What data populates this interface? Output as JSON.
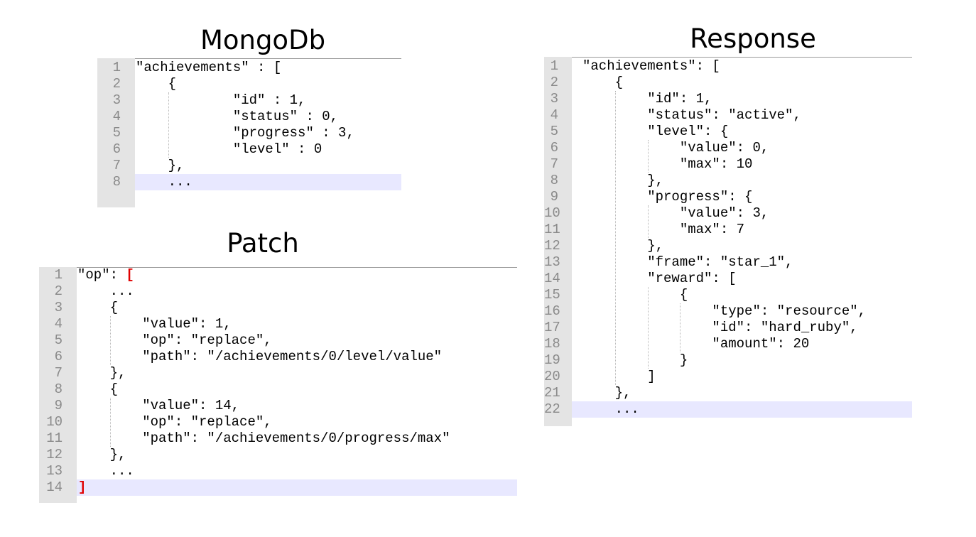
{
  "mongodb": {
    "title": "MongoDb",
    "lines": [
      "\"achievements\" : [",
      "    {",
      "            \"id\" : 1,",
      "            \"status\" : 0,",
      "            \"progress\" : 3,",
      "            \"level\" : 0",
      "    },",
      "    ..."
    ],
    "highlight_line": 8
  },
  "patch": {
    "title": "Patch",
    "lines": [
      "\"op\": [",
      "    ...",
      "    {",
      "        \"value\": 1,",
      "        \"op\": \"replace\",",
      "        \"path\": \"/achievements/0/level/value\"",
      "    },",
      "    {",
      "        \"value\": 14,",
      "        \"op\": \"replace\",",
      "        \"path\": \"/achievements/0/progress/max\"",
      "    },",
      "    ...",
      "]"
    ],
    "highlight_line": 14,
    "accent_color": "#e00000"
  },
  "response": {
    "title": "Response",
    "lines": [
      "\"achievements\": [",
      "    {",
      "        \"id\": 1,",
      "        \"status\": \"active\",",
      "        \"level\": {",
      "            \"value\": 0,",
      "            \"max\": 10",
      "        },",
      "        \"progress\": {",
      "            \"value\": 3,",
      "            \"max\": 7",
      "        },",
      "        \"frame\": \"star_1\",",
      "        \"reward\": [",
      "            {",
      "                \"type\": \"resource\",",
      "                \"id\": \"hard_ruby\",",
      "                \"amount\": 20",
      "            }",
      "        ]",
      "    },",
      "    ..."
    ],
    "highlight_line": 22
  }
}
